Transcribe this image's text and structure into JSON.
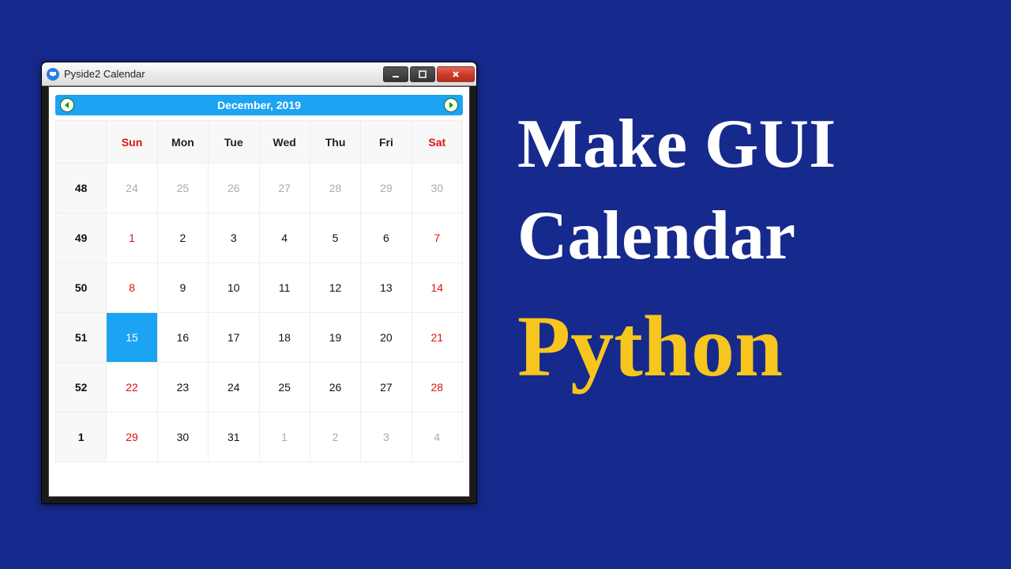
{
  "window": {
    "title": "Pyside2 Calendar"
  },
  "calendar": {
    "month_label": "December,   2019",
    "headers": [
      "",
      "Sun",
      "Mon",
      "Tue",
      "Wed",
      "Thu",
      "Fri",
      "Sat"
    ],
    "weekend_cols": [
      1,
      7
    ],
    "selected": {
      "row": 3,
      "col": 1
    },
    "rows": [
      {
        "week": "48",
        "days": [
          {
            "n": "24",
            "outside": true
          },
          {
            "n": "25",
            "outside": true
          },
          {
            "n": "26",
            "outside": true
          },
          {
            "n": "27",
            "outside": true
          },
          {
            "n": "28",
            "outside": true
          },
          {
            "n": "29",
            "outside": true
          },
          {
            "n": "30",
            "outside": true
          }
        ]
      },
      {
        "week": "49",
        "days": [
          {
            "n": "1"
          },
          {
            "n": "2"
          },
          {
            "n": "3"
          },
          {
            "n": "4"
          },
          {
            "n": "5"
          },
          {
            "n": "6"
          },
          {
            "n": "7"
          }
        ]
      },
      {
        "week": "50",
        "days": [
          {
            "n": "8"
          },
          {
            "n": "9"
          },
          {
            "n": "10"
          },
          {
            "n": "11"
          },
          {
            "n": "12"
          },
          {
            "n": "13"
          },
          {
            "n": "14"
          }
        ]
      },
      {
        "week": "51",
        "days": [
          {
            "n": "15"
          },
          {
            "n": "16"
          },
          {
            "n": "17"
          },
          {
            "n": "18"
          },
          {
            "n": "19"
          },
          {
            "n": "20"
          },
          {
            "n": "21"
          }
        ]
      },
      {
        "week": "52",
        "days": [
          {
            "n": "22"
          },
          {
            "n": "23"
          },
          {
            "n": "24"
          },
          {
            "n": "25"
          },
          {
            "n": "26"
          },
          {
            "n": "27"
          },
          {
            "n": "28"
          }
        ]
      },
      {
        "week": "1",
        "days": [
          {
            "n": "29"
          },
          {
            "n": "30"
          },
          {
            "n": "31"
          },
          {
            "n": "1",
            "outside": true
          },
          {
            "n": "2",
            "outside": true
          },
          {
            "n": "3",
            "outside": true
          },
          {
            "n": "4",
            "outside": true
          }
        ]
      }
    ]
  },
  "headline": {
    "line1": "Make GUI",
    "line2": "Calendar",
    "line3": "Python"
  }
}
